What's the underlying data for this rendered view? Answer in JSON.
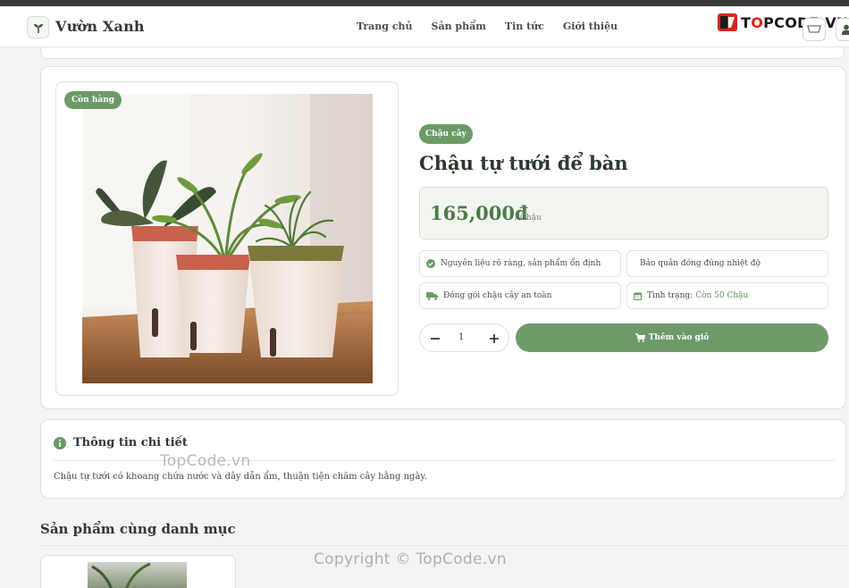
{
  "header": {
    "brand": "Vườn Xanh",
    "nav": [
      "Trang chủ",
      "Sản phẩm",
      "Tin tức",
      "Giới thiệu"
    ],
    "watermark_logo": {
      "prefix": "T",
      "o": "O",
      "rest": "PCODE.VN"
    }
  },
  "product": {
    "stock_badge": "Còn hàng",
    "category": "Chậu cây",
    "title": "Chậu tự tưới để bàn",
    "price": "165,000đ",
    "unit": "/ Chậu",
    "features": {
      "f1": "Nguyên liệu rõ ràng, sản phẩm ổn định",
      "f2": "Bảo quản đóng đúng nhiệt độ",
      "f3": "Đóng gói chậu cây an toàn",
      "f4_label": "Tình trạng:",
      "f4_value": "Còn 50 Chậu"
    },
    "quantity": "1",
    "add_to_cart": "Thêm vào giỏ"
  },
  "details": {
    "heading": "Thông tin chi tiết",
    "text": "Chậu tự tưới có khoang chứa nước và dây dẫn ẩm, thuận tiện chăm cây hằng ngày."
  },
  "related": {
    "heading": "Sản phẩm cùng danh mục"
  },
  "watermarks": {
    "w1": "TopCode.vn",
    "w2": "Copyright © TopCode.vn"
  },
  "colors": {
    "accent": "#6b9a67",
    "price": "#4e7a4b",
    "brand_red": "#d7261e"
  },
  "icons": [
    "leaf-icon",
    "cart-icon",
    "user-icon",
    "check-circle-icon",
    "truck-icon",
    "calendar-icon",
    "minus-icon",
    "plus-icon",
    "info-icon"
  ]
}
